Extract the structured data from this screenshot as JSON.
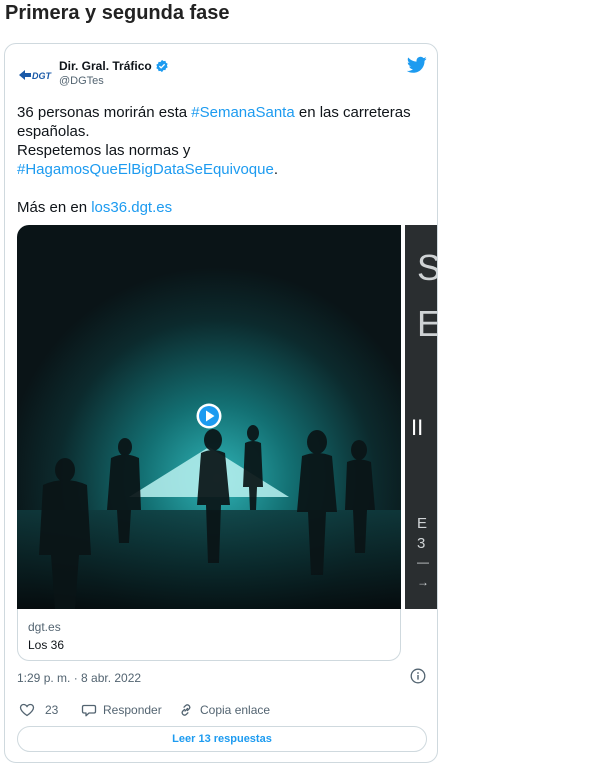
{
  "page": {
    "title": "Primera y segunda fase"
  },
  "tweet": {
    "account_name": "Dir. Gral. Tráfico",
    "handle": "@DGTes",
    "logo_text": "DGT",
    "text": {
      "line1_prefix": "36 personas morirán esta ",
      "hashtag1": "#SemanaSanta",
      "line1_suffix": " en las carreteras",
      "line2": "españolas.",
      "line3": "Respetemos las normas y",
      "hashtag2": "#HagamosQueElBigDataSeEquivoque",
      "line3_suffix": ".",
      "line5_prefix": "Más en en ",
      "link": "los36.dgt.es"
    },
    "media": {
      "next_slide_fragments": [
        "S",
        "E",
        "II",
        "E",
        "3",
        "—",
        "→"
      ]
    },
    "link_card": {
      "domain": "dgt.es",
      "title": "Los 36"
    },
    "timestamp": "1:29 p. m. · 8 abr. 2022",
    "actions": {
      "likes": "23",
      "reply": "Responder",
      "copy_link": "Copia enlace"
    },
    "read_replies": "Leer 13 respuestas"
  },
  "colors": {
    "accent": "#1d9bf0",
    "text": "#0f1419",
    "muted": "#536471",
    "border": "#cfd9de"
  },
  "icons": [
    "verified-badge-icon",
    "twitter-bird-icon",
    "play-icon",
    "info-icon",
    "heart-icon",
    "reply-icon",
    "link-icon"
  ]
}
